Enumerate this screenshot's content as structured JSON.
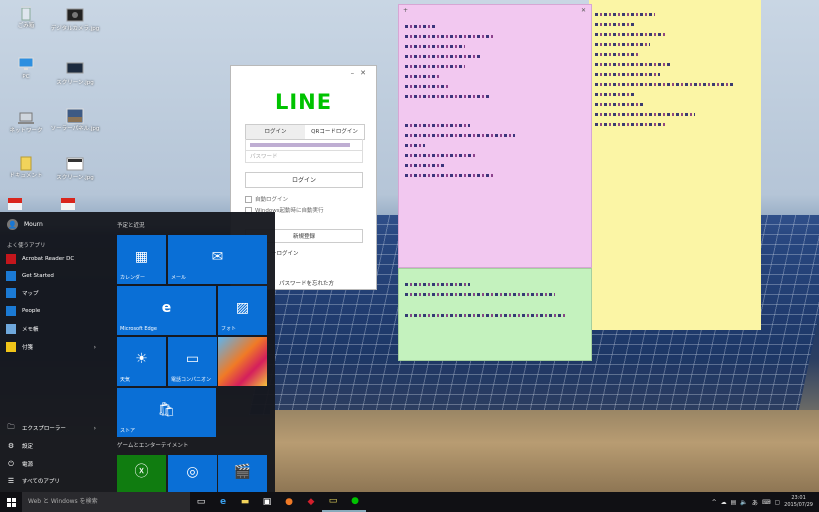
{
  "desktop": {
    "icons": [
      {
        "label": "ごみ箱",
        "icon": "recycle-bin-icon"
      },
      {
        "label": "デジタルカメラ.jpg",
        "icon": "image-file-icon"
      },
      {
        "label": "PC",
        "icon": "computer-icon"
      },
      {
        "label": "スクリーン.jpg",
        "icon": "image-file-icon"
      },
      {
        "label": "ネットワーク",
        "icon": "network-icon"
      },
      {
        "label": "ソーラーパネル.jpg",
        "icon": "image-file-icon"
      },
      {
        "label": "ドキュメント",
        "icon": "folder-icon"
      },
      {
        "label": "スクリーン.jpg",
        "icon": "image-file-icon"
      }
    ]
  },
  "line_window": {
    "logo": "LINE",
    "tabs": [
      "ログイン",
      "QRコードログイン"
    ],
    "password_placeholder": "パスワード",
    "login_button": "ログイン",
    "auto_login_label": "自動ログイン",
    "auto_start_label": "Windows起動時に自動実行",
    "register_button": "新規登録",
    "easy_login_link": "ーログイン",
    "forgot_password_link": "パスワードを忘れた方"
  },
  "start_menu": {
    "user_name": "Mourn",
    "most_used_label": "よく使うアプリ",
    "apps": [
      {
        "label": "Acrobat Reader DC",
        "icon": "acrobat-icon",
        "color": "#c4161c"
      },
      {
        "label": "Get Started",
        "icon": "lightbulb-icon",
        "color": "#1b7ad4"
      },
      {
        "label": "マップ",
        "icon": "maps-icon",
        "color": "#1b7ad4"
      },
      {
        "label": "People",
        "icon": "people-icon",
        "color": "#1b7ad4"
      },
      {
        "label": "メモ帳",
        "icon": "notepad-icon",
        "color": "#6fa8dc"
      },
      {
        "label": "付箋",
        "icon": "sticky-notes-icon",
        "color": "#f0c419"
      }
    ],
    "bottom_items": [
      {
        "label": "エクスプローラー",
        "icon": "folder-icon",
        "glyph": "🗀"
      },
      {
        "label": "設定",
        "icon": "gear-icon",
        "glyph": "⚙"
      },
      {
        "label": "電源",
        "icon": "power-icon",
        "glyph": "⏻"
      },
      {
        "label": "すべてのアプリ",
        "icon": "all-apps-icon",
        "glyph": "☰"
      }
    ],
    "tiles_heading_1": "予定と近況",
    "tiles_heading_2": "ゲームとエンターテイメント",
    "tiles": [
      {
        "label": "カレンダー",
        "icon": "calendar-icon",
        "glyph": "▦"
      },
      {
        "label": "メール",
        "icon": "mail-icon",
        "glyph": "✉"
      },
      {
        "label": "Microsoft Edge",
        "icon": "edge-icon",
        "glyph": "e"
      },
      {
        "label": "フォト",
        "icon": "photos-icon",
        "glyph": "▨"
      },
      {
        "label": "天気",
        "icon": "weather-icon",
        "glyph": "☀"
      },
      {
        "label": "電話コンパニオン",
        "icon": "phone-companion-icon",
        "glyph": "▭"
      },
      {
        "label": "",
        "icon": "candy-crush-icon",
        "glyph": ""
      },
      {
        "label": "ストア",
        "icon": "store-icon",
        "glyph": "🛍"
      },
      {
        "label": "",
        "icon": "xbox-icon",
        "glyph": "ⓧ"
      },
      {
        "label": "",
        "icon": "groove-music-icon",
        "glyph": "◎"
      },
      {
        "label": "",
        "icon": "movies-icon",
        "glyph": "🎬"
      }
    ]
  },
  "taskbar": {
    "search_placeholder": "Web と Windows を検索",
    "apps": [
      {
        "icon": "task-view-icon",
        "glyph": "▭"
      },
      {
        "icon": "edge-icon",
        "glyph": "e"
      },
      {
        "icon": "file-explorer-icon",
        "glyph": "▬"
      },
      {
        "icon": "store-icon",
        "glyph": "▣"
      },
      {
        "icon": "firefox-icon",
        "glyph": "●"
      },
      {
        "icon": "app-icon",
        "glyph": "◆"
      },
      {
        "icon": "sticky-notes-icon",
        "glyph": "▭"
      },
      {
        "icon": "line-icon",
        "glyph": "●"
      }
    ],
    "time": "23:01",
    "date": "2015/07/29"
  },
  "colors": {
    "start_bg": "#16181e",
    "tile_blue": "#0a6fd6",
    "line_green": "#00c300",
    "note_yellow": "#fbf5a5",
    "note_pink": "#f2c8f0",
    "note_green": "#c4f2be"
  }
}
